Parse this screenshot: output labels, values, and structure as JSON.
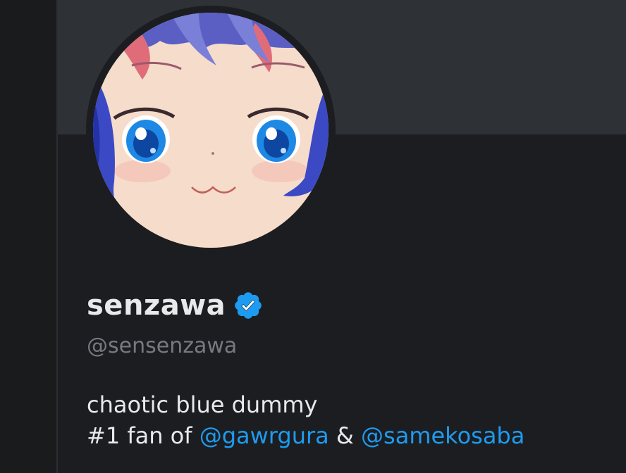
{
  "profile": {
    "display_name": "senzawa",
    "verified": true,
    "handle": "@sensenzawa",
    "bio": {
      "line1": "chaotic blue dummy",
      "line2_prefix": "#1 fan of ",
      "mention1": "@gawrgura",
      "separator": " & ",
      "mention2": "@samekosaba"
    }
  },
  "icons": {
    "verified": "verified-badge-icon",
    "avatar": "anime-face-avatar"
  },
  "colors": {
    "background": "#1c1d20",
    "banner": "#2e3135",
    "text_primary": "#e8e9eb",
    "text_secondary": "#767a80",
    "link": "#1d9bf0",
    "verified": "#1d9bf0"
  }
}
